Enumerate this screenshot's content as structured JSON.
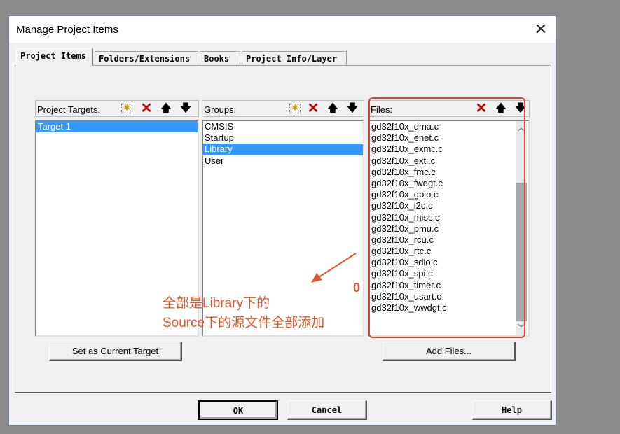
{
  "window": {
    "title": "Manage Project Items"
  },
  "tabs": [
    {
      "label": "Project Items",
      "active": true
    },
    {
      "label": "Folders/Extensions",
      "active": false
    },
    {
      "label": "Books",
      "active": false
    },
    {
      "label": "Project Info/Layer",
      "active": false
    }
  ],
  "targets": {
    "label": "Project Targets:",
    "items": [
      "Target 1"
    ],
    "selected_index": 0,
    "button": "Set as Current Target"
  },
  "groups": {
    "label": "Groups:",
    "items": [
      "CMSIS",
      "Startup",
      "Library",
      "User"
    ],
    "selected_index": 2
  },
  "files": {
    "label": "Files:",
    "items": [
      "gd32f10x_dma.c",
      "gd32f10x_enet.c",
      "gd32f10x_exmc.c",
      "gd32f10x_exti.c",
      "gd32f10x_fmc.c",
      "gd32f10x_fwdgt.c",
      "gd32f10x_gpio.c",
      "gd32f10x_i2c.c",
      "gd32f10x_misc.c",
      "gd32f10x_pmu.c",
      "gd32f10x_rcu.c",
      "gd32f10x_rtc.c",
      "gd32f10x_sdio.c",
      "gd32f10x_spi.c",
      "gd32f10x_timer.c",
      "gd32f10x_usart.c",
      "gd32f10x_wwdgt.c"
    ],
    "button": "Add Files..."
  },
  "annotation": {
    "line1": "全部是Library下的",
    "line2": "Source下的源文件全部添加",
    "mark": "0",
    "color": "#e2562a"
  },
  "footer": {
    "ok": "OK",
    "cancel": "Cancel",
    "help": "Help"
  },
  "icons": {
    "new": "new-item-icon",
    "delete": "delete-icon",
    "up": "move-up-icon",
    "down": "move-down-icon",
    "close": "close-icon"
  }
}
